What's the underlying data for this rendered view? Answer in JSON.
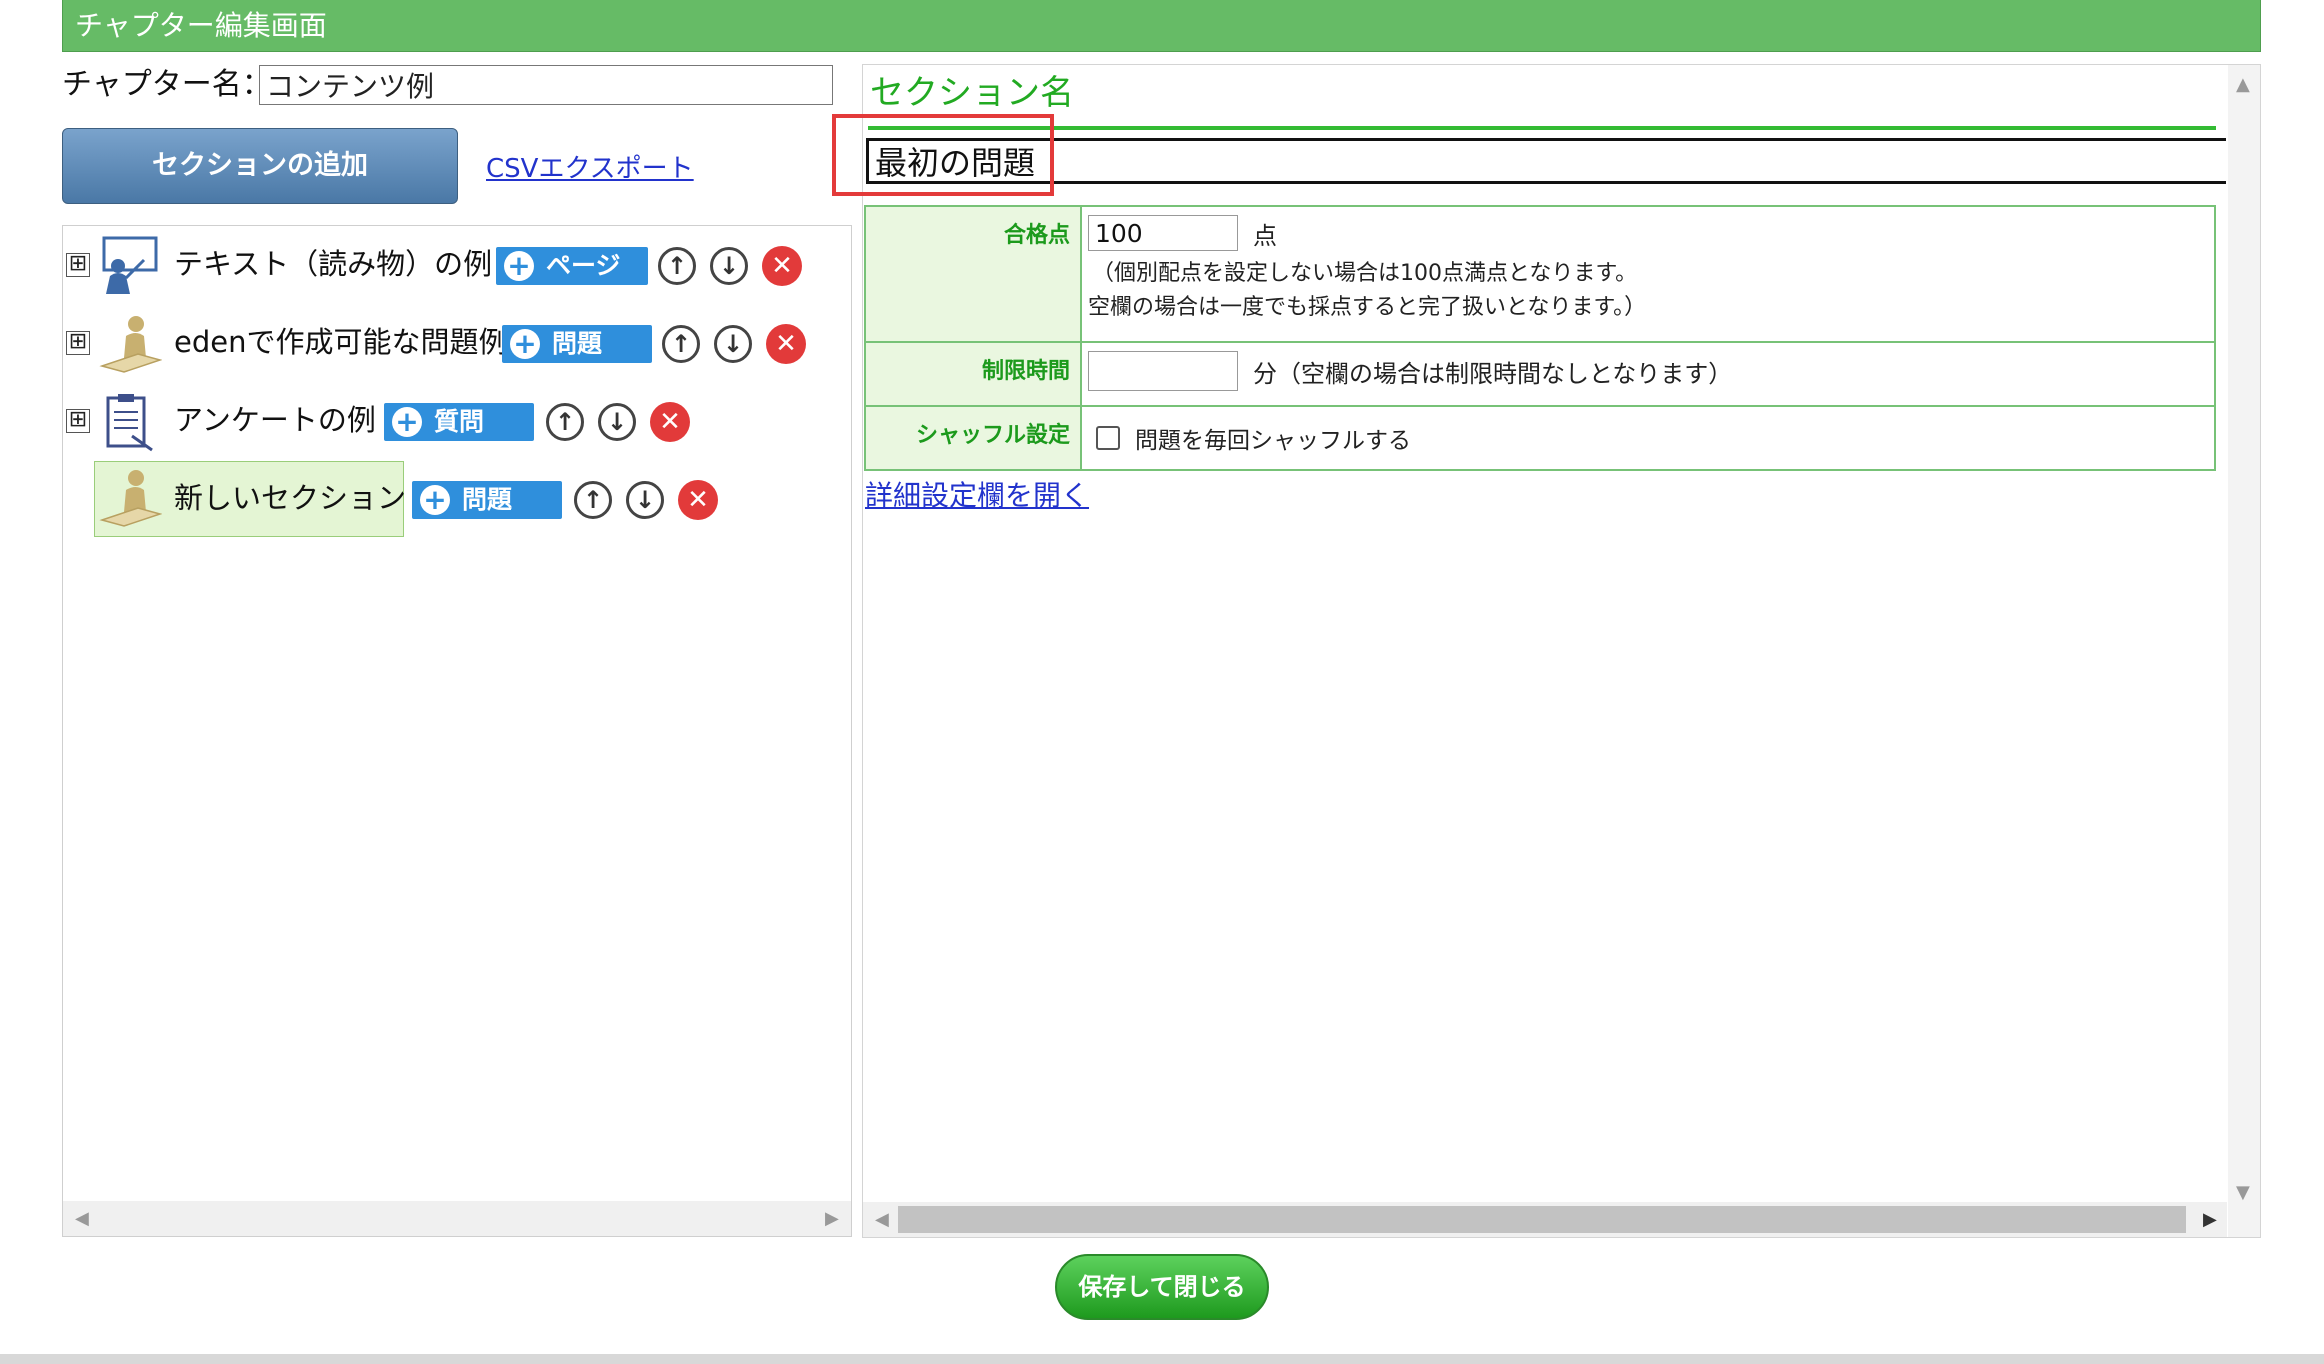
{
  "header": {
    "title": "チャプター編集画面"
  },
  "chapter": {
    "label": "チャプター名：",
    "value": "コンテンツ例"
  },
  "toolbar": {
    "add_section": "セクションの追加",
    "csv_export": "CSVエクスポート"
  },
  "tree": [
    {
      "label": "テキスト（読み物）の例",
      "add_label": "ページ",
      "icon": "teacher-board-icon"
    },
    {
      "label": "edenで作成可能な問題例",
      "add_label": "問題",
      "icon": "student-desk-icon"
    },
    {
      "label": "アンケートの例",
      "add_label": "質問",
      "icon": "clipboard-icon"
    },
    {
      "label": "新しいセクション",
      "add_label": "問題",
      "icon": "student-desk-icon",
      "selected": true
    }
  ],
  "icons": {
    "expand": "⊞",
    "up": "↑",
    "down": "↓",
    "delete": "✕",
    "plus": "+"
  },
  "section": {
    "heading": "セクション名",
    "name_value": "最初の問題",
    "passing": {
      "label": "合格点",
      "value": "100",
      "unit": "点",
      "note1": "（個別配点を設定しない場合は100点満点となります。",
      "note2": "空欄の場合は一度でも採点すると完了扱いとなります。）"
    },
    "time_limit": {
      "label": "制限時間",
      "value": "",
      "note": "分（空欄の場合は制限時間なしとなります）"
    },
    "shuffle": {
      "label": "シャッフル設定",
      "checkbox_label": "問題を毎回シャッフルする",
      "checked": false
    },
    "details_link": "詳細設定欄を開く"
  },
  "footer": {
    "save_close": "保存して閉じる"
  },
  "colors": {
    "header_green": "#66bb66",
    "accent_green": "#22aa22",
    "pill_blue": "#2f8fdc",
    "delete_red": "#e23a3a"
  }
}
